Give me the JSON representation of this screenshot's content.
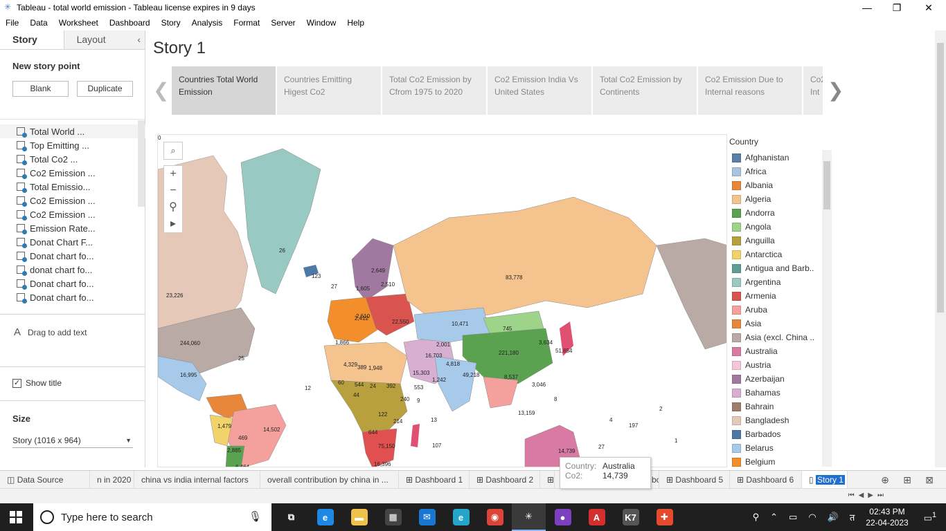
{
  "window": {
    "title": "Tableau - total world emission - Tableau license expires in 9 days",
    "controls": {
      "minimize": "—",
      "restore": "❐",
      "close": "✕"
    }
  },
  "menu": [
    "File",
    "Data",
    "Worksheet",
    "Dashboard",
    "Story",
    "Analysis",
    "Format",
    "Server",
    "Window",
    "Help"
  ],
  "left_pane": {
    "tab_story": "Story",
    "tab_layout": "Layout",
    "collapse": "‹",
    "new_story_point": "New story point",
    "blank_btn": "Blank",
    "duplicate_btn": "Duplicate",
    "sheets": [
      "Total World ...",
      "Top Emitting ...",
      "Total Co2 ...",
      "Co2 Emission ...",
      "Total Emissio...",
      "Co2 Emission ...",
      "Co2 Emission ...",
      "Emission Rate...",
      "Donat Chart F...",
      "Donat chart fo...",
      "donat chart fo...",
      "Donat chart fo...",
      "Donat chart fo..."
    ],
    "drag_text_icon": "A",
    "drag_text": "Drag to add text",
    "show_title": "Show title",
    "show_title_check": "✓",
    "size_label": "Size",
    "size_value": "Story (1016 x 964)"
  },
  "story": {
    "title": "Story 1",
    "prev_arrow": "❮",
    "next_arrow": "❯",
    "points": [
      "Countries Total World Emission",
      "Countries Emitting Higest Co2",
      "Total Co2 Emission by Cfrom 1975 to 2020",
      "Co2 Emission India Vs United States",
      "Total Co2 Emission by Continents",
      "Co2 Emission Due to Internal reasons",
      "Co2 Int"
    ]
  },
  "map": {
    "tools": {
      "search": "⌕",
      "zoom_in": "+",
      "zoom_out": "−",
      "pin": "⚲",
      "more": "▸"
    },
    "labels": [
      "26",
      "123",
      "23,226",
      "244,060",
      "25",
      "16,995",
      "83,778",
      "221,180",
      "10,471",
      "745",
      "2,649",
      "2,510",
      "1,605",
      "27",
      "4,329",
      "1,948",
      "14,502",
      "14,739",
      "49,218",
      "16,703",
      "4,818",
      "15,303",
      "1,242",
      "2,001",
      "3,634",
      "51,854",
      "22,550",
      "1,866",
      "2,412",
      "2,610",
      "389",
      "544",
      "24",
      "392",
      "60",
      "44",
      "122",
      "214",
      "644",
      "75,150",
      "16,396",
      "240",
      "553",
      "12",
      "9",
      "2,885",
      "1,479",
      "469",
      "6,464",
      "13,159",
      "8,537",
      "3,046",
      "107",
      "13",
      "8",
      "4",
      "2",
      "1",
      "27",
      "197",
      "0"
    ]
  },
  "tooltip": {
    "country_key": "Country:",
    "country_val": "Australia",
    "co2_key": "Co2:",
    "co2_val": "14,739"
  },
  "legend": {
    "title": "Country",
    "items": [
      {
        "name": "Afghanistan",
        "color": "#5b7fa6"
      },
      {
        "name": "Africa",
        "color": "#a8c4de"
      },
      {
        "name": "Albania",
        "color": "#e8873a"
      },
      {
        "name": "Algeria",
        "color": "#f5c38e"
      },
      {
        "name": "Andorra",
        "color": "#5aa250"
      },
      {
        "name": "Angola",
        "color": "#9ed38a"
      },
      {
        "name": "Anguilla",
        "color": "#b8a03e"
      },
      {
        "name": "Antarctica",
        "color": "#f2d36b"
      },
      {
        "name": "Antigua and Barb..",
        "color": "#5f9e96"
      },
      {
        "name": "Argentina",
        "color": "#98c9c2"
      },
      {
        "name": "Armenia",
        "color": "#d9534f"
      },
      {
        "name": "Aruba",
        "color": "#f4a09c"
      },
      {
        "name": "Asia",
        "color": "#e8873a"
      },
      {
        "name": "Asia (excl. China ..",
        "color": "#b9aaa5"
      },
      {
        "name": "Australia",
        "color": "#d87aa3"
      },
      {
        "name": "Austria",
        "color": "#f5c6d8"
      },
      {
        "name": "Azerbaijan",
        "color": "#a179a0"
      },
      {
        "name": "Bahamas",
        "color": "#d9afd1"
      },
      {
        "name": "Bahrain",
        "color": "#9e7d6c"
      },
      {
        "name": "Bangladesh",
        "color": "#e5c8b8"
      },
      {
        "name": "Barbados",
        "color": "#4e79a7"
      },
      {
        "name": "Belarus",
        "color": "#a7c9ea"
      },
      {
        "name": "Belgium",
        "color": "#f28e2b"
      }
    ]
  },
  "sheet_tabs": [
    {
      "label": "Data Source",
      "icon": "◫"
    },
    {
      "label": "n in 2020",
      "icon": ""
    },
    {
      "label": "china vs india internal factors",
      "icon": ""
    },
    {
      "label": "overall contribution by china in ...",
      "icon": ""
    },
    {
      "label": "Dashboard 1",
      "icon": "⊞"
    },
    {
      "label": "Dashboard 2",
      "icon": "⊞"
    },
    {
      "label": "",
      "icon": "⊞"
    },
    {
      "label": "board 4",
      "icon": ""
    },
    {
      "label": "Dashboard 5",
      "icon": "⊞"
    },
    {
      "label": "Dashboard 6",
      "icon": "⊞"
    }
  ],
  "active_tab": {
    "label": "Story 1",
    "icon": "▯"
  },
  "tab_tools": [
    "⊕",
    "⊞",
    "⊠"
  ],
  "status_nav": "⏮◀▶⏭",
  "taskbar": {
    "search_placeholder": "Type here to search",
    "mic": "🎙",
    "apps": [
      {
        "name": "task-view",
        "glyph": "⧉",
        "color": "#1f1f1f"
      },
      {
        "name": "edge-legacy",
        "glyph": "e",
        "color": "#1e88e5"
      },
      {
        "name": "file-explorer",
        "glyph": "▬",
        "color": "#f0c14b"
      },
      {
        "name": "store",
        "glyph": "▦",
        "color": "#444"
      },
      {
        "name": "mail",
        "glyph": "✉",
        "color": "#1976d2"
      },
      {
        "name": "edge",
        "glyph": "e",
        "color": "#23a6c9"
      },
      {
        "name": "chrome",
        "glyph": "◉",
        "color": "#db4437"
      },
      {
        "name": "tableau",
        "glyph": "✳",
        "color": "#3a3a3a"
      },
      {
        "name": "github",
        "glyph": "●",
        "color": "#7b3fbf"
      },
      {
        "name": "acrobat",
        "glyph": "A",
        "color": "#d32f2f"
      },
      {
        "name": "k7",
        "glyph": "K7",
        "color": "#555"
      },
      {
        "name": "other",
        "glyph": "✚",
        "color": "#e34a2e"
      }
    ],
    "tray_icons": [
      "⚲",
      "⌃",
      "▭",
      "◠",
      "🔊",
      "त"
    ],
    "time": "02:43 PM",
    "date": "22-04-2023",
    "notif": "▭",
    "notif_count": "1"
  }
}
